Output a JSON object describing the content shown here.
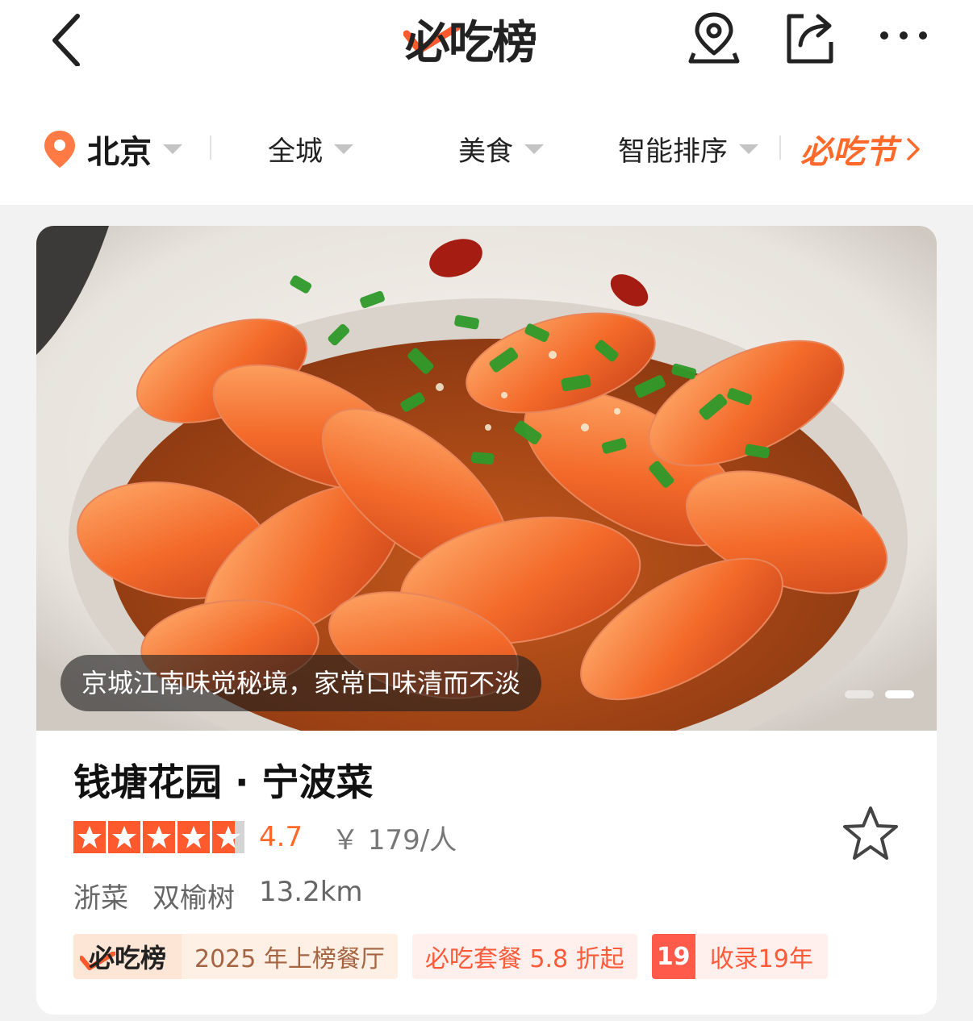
{
  "header": {
    "logo_text": "必吃榜",
    "icons": [
      "back-icon",
      "map-pin-icon",
      "share-icon",
      "more-icon"
    ]
  },
  "filters": {
    "city": "北京",
    "area": "全城",
    "category": "美食",
    "sort": "智能排序",
    "festival": "必吃节"
  },
  "restaurant": {
    "caption": "京城江南味觉秘境，家常口味清而不淡",
    "carousel_total": 2,
    "carousel_active_index": 2,
    "name": "钱塘花园 · 宁波菜",
    "rating": 4.7,
    "rating_text": "4.7",
    "price": "￥ 179/人",
    "cuisine": "浙菜",
    "district": "双榆树",
    "distance": "13.2km",
    "tags": {
      "rank_badge": "必吃榜",
      "rank_text": "2025 年上榜餐厅",
      "deal": "必吃套餐 5.8 折起",
      "years_num": "19",
      "years_text": "收录19年"
    }
  },
  "colors": {
    "accent": "#ff6a2a",
    "star": "#ff5a2e",
    "star_empty": "#d4d4d4"
  }
}
